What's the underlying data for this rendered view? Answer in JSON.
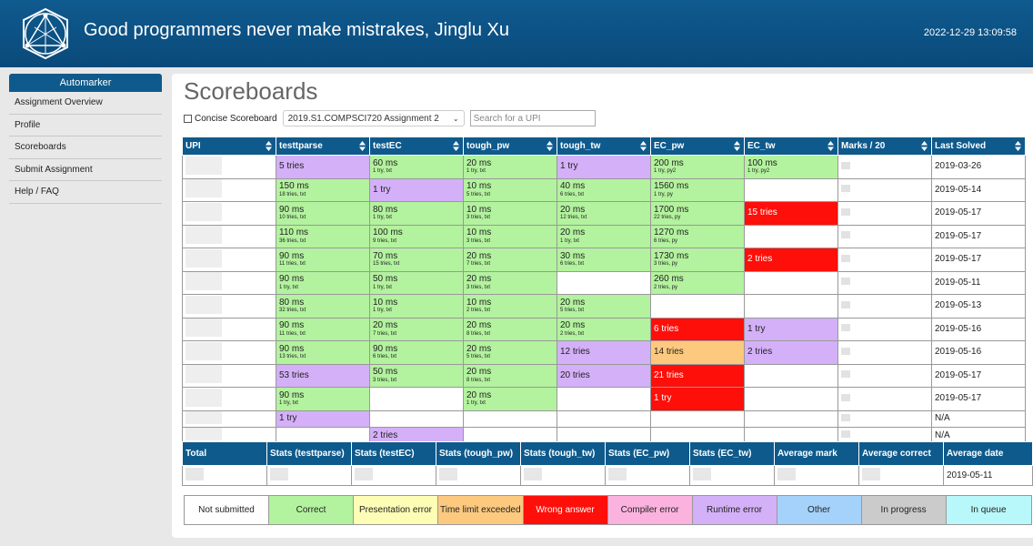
{
  "header": {
    "title": "Good programmers never make mistrakes, Jinglu Xu",
    "datetime": "2022-12-29 13:09:58"
  },
  "sidebar": {
    "heading": "Automarker",
    "items": [
      {
        "label": "Assignment Overview"
      },
      {
        "label": "Profile"
      },
      {
        "label": "Scoreboards"
      },
      {
        "label": "Submit Assignment"
      },
      {
        "label": "Help / FAQ"
      }
    ]
  },
  "page": {
    "title": "Scoreboards",
    "concise_label": "Concise Scoreboard",
    "assignment_select": "2019.S1.COMPSCI720 Assignment 2",
    "search_placeholder": "Search for a UPI"
  },
  "scoreboard": {
    "columns": [
      "UPI",
      "testtparse",
      "testEC",
      "tough_pw",
      "tough_tw",
      "EC_pw",
      "EC_tw",
      "Marks / 20",
      "Last Solved"
    ],
    "rows": [
      {
        "cells": [
          {
            "s": "runtime",
            "main": "5 tries"
          },
          {
            "s": "correct",
            "main": "60 ms",
            "sub": "1 try, txt"
          },
          {
            "s": "correct",
            "main": "20 ms",
            "sub": "1 try, txt"
          },
          {
            "s": "runtime",
            "main": "1 try"
          },
          {
            "s": "correct",
            "main": "200 ms",
            "sub": "1 try, py2"
          },
          {
            "s": "correct",
            "main": "100 ms",
            "sub": "1 try, py2"
          }
        ],
        "last": "2019-03-26"
      },
      {
        "cells": [
          {
            "s": "correct",
            "main": "150 ms",
            "sub": "18 tries, txt"
          },
          {
            "s": "runtime",
            "main": "1 try"
          },
          {
            "s": "correct",
            "main": "10 ms",
            "sub": "5 tries, txt"
          },
          {
            "s": "correct",
            "main": "40 ms",
            "sub": "6 tries, txt"
          },
          {
            "s": "correct",
            "main": "1560 ms",
            "sub": "1 try, py"
          },
          {
            "s": "none"
          }
        ],
        "last": "2019-05-14"
      },
      {
        "cells": [
          {
            "s": "correct",
            "main": "90 ms",
            "sub": "10 tries, txt"
          },
          {
            "s": "correct",
            "main": "80 ms",
            "sub": "1 try, txt"
          },
          {
            "s": "correct",
            "main": "10 ms",
            "sub": "3 tries, txt"
          },
          {
            "s": "correct",
            "main": "20 ms",
            "sub": "12 tries, txt"
          },
          {
            "s": "correct",
            "main": "1700 ms",
            "sub": "22 tries, py"
          },
          {
            "s": "wrong",
            "main": "15 tries"
          }
        ],
        "last": "2019-05-17"
      },
      {
        "cells": [
          {
            "s": "correct",
            "main": "110 ms",
            "sub": "36 tries, txt"
          },
          {
            "s": "correct",
            "main": "100 ms",
            "sub": "9 tries, txt"
          },
          {
            "s": "correct",
            "main": "10 ms",
            "sub": "3 tries, txt"
          },
          {
            "s": "correct",
            "main": "20 ms",
            "sub": "1 try, txt"
          },
          {
            "s": "correct",
            "main": "1270 ms",
            "sub": "6 tries, py"
          },
          {
            "s": "none"
          }
        ],
        "last": "2019-05-17"
      },
      {
        "cells": [
          {
            "s": "correct",
            "main": "90 ms",
            "sub": "11 tries, txt"
          },
          {
            "s": "correct",
            "main": "70 ms",
            "sub": "15 tries, txt"
          },
          {
            "s": "correct",
            "main": "20 ms",
            "sub": "7 tries, txt"
          },
          {
            "s": "correct",
            "main": "30 ms",
            "sub": "6 tries, txt"
          },
          {
            "s": "correct",
            "main": "1730 ms",
            "sub": "3 tries, py"
          },
          {
            "s": "wrong",
            "main": "2 tries"
          }
        ],
        "last": "2019-05-17"
      },
      {
        "cells": [
          {
            "s": "correct",
            "main": "90 ms",
            "sub": "1 try, txt"
          },
          {
            "s": "correct",
            "main": "50 ms",
            "sub": "1 try, txt"
          },
          {
            "s": "correct",
            "main": "20 ms",
            "sub": "3 tries, txt"
          },
          {
            "s": "none"
          },
          {
            "s": "correct",
            "main": "260 ms",
            "sub": "2 tries, py"
          },
          {
            "s": "none"
          }
        ],
        "last": "2019-05-11"
      },
      {
        "cells": [
          {
            "s": "correct",
            "main": "80 ms",
            "sub": "32 tries, txt"
          },
          {
            "s": "correct",
            "main": "10 ms",
            "sub": "1 try, txt"
          },
          {
            "s": "correct",
            "main": "10 ms",
            "sub": "2 tries, txt"
          },
          {
            "s": "correct",
            "main": "20 ms",
            "sub": "5 tries, txt"
          },
          {
            "s": "none"
          },
          {
            "s": "none"
          }
        ],
        "last": "2019-05-13"
      },
      {
        "cells": [
          {
            "s": "correct",
            "main": "90 ms",
            "sub": "11 tries, txt"
          },
          {
            "s": "correct",
            "main": "20 ms",
            "sub": "7 tries, txt"
          },
          {
            "s": "correct",
            "main": "20 ms",
            "sub": "8 tries, txt"
          },
          {
            "s": "correct",
            "main": "20 ms",
            "sub": "2 tries, txt"
          },
          {
            "s": "wrong",
            "main": "6 tries"
          },
          {
            "s": "runtime",
            "main": "1 try"
          }
        ],
        "last": "2019-05-16"
      },
      {
        "cells": [
          {
            "s": "correct",
            "main": "90 ms",
            "sub": "13 tries, txt"
          },
          {
            "s": "correct",
            "main": "90 ms",
            "sub": "6 tries, txt"
          },
          {
            "s": "correct",
            "main": "20 ms",
            "sub": "5 tries, txt"
          },
          {
            "s": "runtime",
            "main": "12 tries"
          },
          {
            "s": "tle",
            "main": "14 tries"
          },
          {
            "s": "runtime",
            "main": "2 tries"
          }
        ],
        "last": "2019-05-16"
      },
      {
        "cells": [
          {
            "s": "runtime",
            "main": "53 tries"
          },
          {
            "s": "correct",
            "main": "50 ms",
            "sub": "3 tries, txt"
          },
          {
            "s": "correct",
            "main": "20 ms",
            "sub": "8 tries, txt"
          },
          {
            "s": "runtime",
            "main": "20 tries"
          },
          {
            "s": "wrong",
            "main": "21 tries"
          },
          {
            "s": "none"
          }
        ],
        "last": "2019-05-17"
      },
      {
        "cells": [
          {
            "s": "correct",
            "main": "90 ms",
            "sub": "1 try, txt"
          },
          {
            "s": "none"
          },
          {
            "s": "correct",
            "main": "20 ms",
            "sub": "1 try, txt"
          },
          {
            "s": "none"
          },
          {
            "s": "wrong",
            "main": "1 try"
          },
          {
            "s": "none"
          }
        ],
        "last": "2019-05-17"
      },
      {
        "short": true,
        "cells": [
          {
            "s": "runtime",
            "main": "1 try"
          },
          {
            "s": "none"
          },
          {
            "s": "none"
          },
          {
            "s": "none"
          },
          {
            "s": "none"
          },
          {
            "s": "none"
          }
        ],
        "last": "N/A"
      },
      {
        "short": true,
        "cells": [
          {
            "s": "none"
          },
          {
            "s": "runtime",
            "main": "2 tries"
          },
          {
            "s": "none"
          },
          {
            "s": "none"
          },
          {
            "s": "none"
          },
          {
            "s": "none"
          }
        ],
        "last": "N/A"
      }
    ]
  },
  "stats": {
    "columns": [
      "Total",
      "Stats (testtparse)",
      "Stats (testEC)",
      "Stats (tough_pw)",
      "Stats (tough_tw)",
      "Stats (EC_pw)",
      "Stats (EC_tw)",
      "Average mark",
      "Average correct",
      "Average date"
    ],
    "average_date": "2019-05-11"
  },
  "legend": [
    {
      "label": "Not submitted",
      "color": "#ffffff",
      "text": "#222222"
    },
    {
      "label": "Correct",
      "color": "#b3f29e",
      "text": "#222222"
    },
    {
      "label": "Presentation error",
      "color": "#fdfdb6",
      "text": "#222222"
    },
    {
      "label": "Time limit exceeded",
      "color": "#fcc97e",
      "text": "#222222"
    },
    {
      "label": "Wrong answer",
      "color": "#ff0f0a",
      "text": "#ffffff"
    },
    {
      "label": "Compiler error",
      "color": "#fbb2de",
      "text": "#222222"
    },
    {
      "label": "Runtime error",
      "color": "#d4b0f8",
      "text": "#222222"
    },
    {
      "label": "Other",
      "color": "#a5d2fb",
      "text": "#222222"
    },
    {
      "label": "In progress",
      "color": "#cbcbcb",
      "text": "#222222"
    },
    {
      "label": "In queue",
      "color": "#b8f8fa",
      "text": "#222222"
    }
  ]
}
